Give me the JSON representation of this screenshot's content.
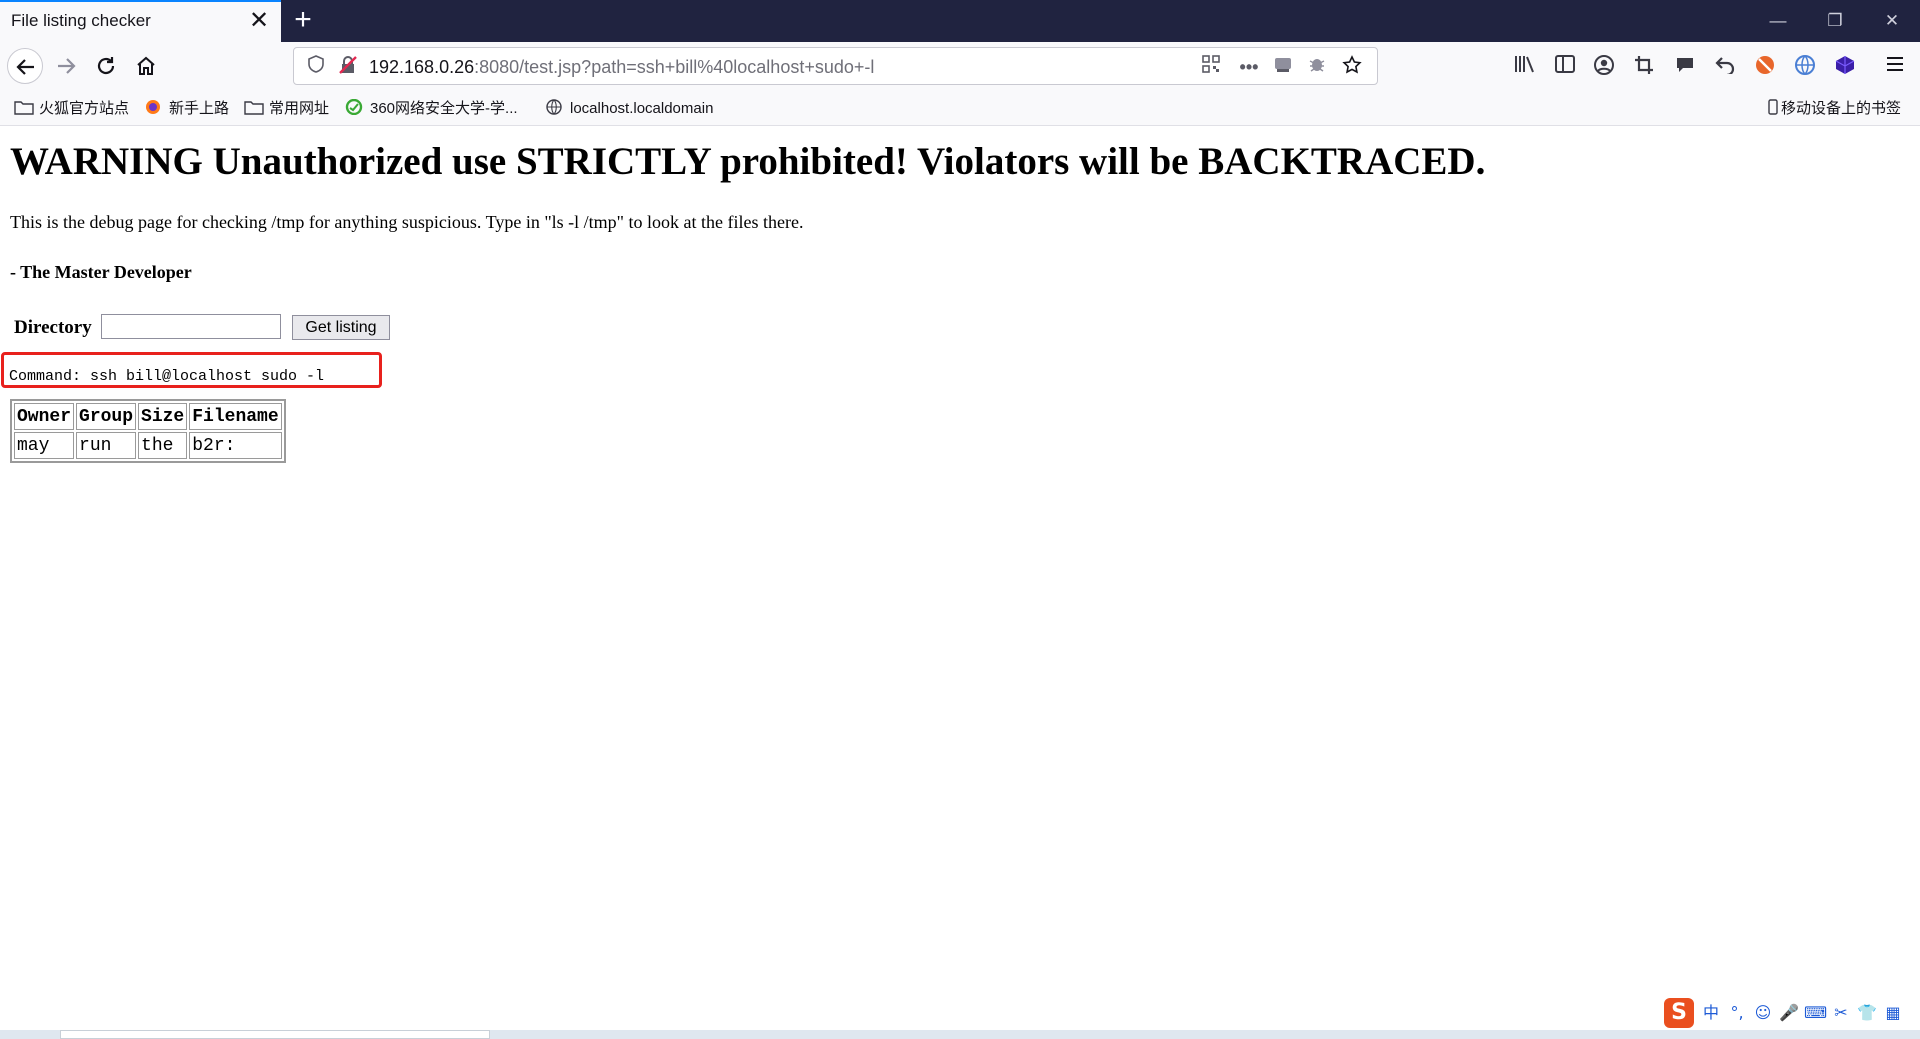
{
  "browser": {
    "tab": {
      "title": "File listing checker",
      "close_glyph": "✕"
    },
    "new_tab_glyph": "+",
    "window_controls": {
      "minimize": "—",
      "restore": "❐",
      "close": "✕"
    },
    "url": {
      "host": "192.168.0.26",
      "rest": ":8080/test.jsp?path=ssh+bill%40localhost+sudo+-l"
    },
    "bookmarks": [
      {
        "label": "火狐官方站点",
        "icon": "folder-icon"
      },
      {
        "label": "新手上路",
        "icon": "firefox-icon"
      },
      {
        "label": "常用网址",
        "icon": "folder-icon"
      },
      {
        "label": "360网络安全大学-学...",
        "icon": "360-icon"
      },
      {
        "label": "localhost.localdomain",
        "icon": "globe-icon"
      }
    ],
    "mobile_bookmarks": "移动设备上的书签"
  },
  "page": {
    "warning": "WARNING Unauthorized use STRICTLY prohibited! Violators will be BACKTRACED.",
    "description": "This is the debug page for checking /tmp for anything suspicious. Type in \"ls -l /tmp\" to look at the files there.",
    "signature": "- The Master Developer",
    "form": {
      "directory_label": "Directory",
      "directory_value": "",
      "submit_label": "Get listing"
    },
    "command": "Command: ssh bill@localhost sudo -l",
    "table": {
      "headers": [
        "Owner",
        "Group",
        "Size",
        "Filename"
      ],
      "rows": [
        [
          "may",
          "run",
          "the",
          "b2r:"
        ]
      ]
    }
  },
  "taskbar": {
    "ime_items": [
      "中",
      "°,",
      "☺",
      "🎤",
      "⌨",
      "✂",
      "👕",
      "▦"
    ]
  },
  "colors": {
    "tabbar_bg": "#202340",
    "accent": "#0a84ff",
    "highlight_box": "#e8211d"
  }
}
